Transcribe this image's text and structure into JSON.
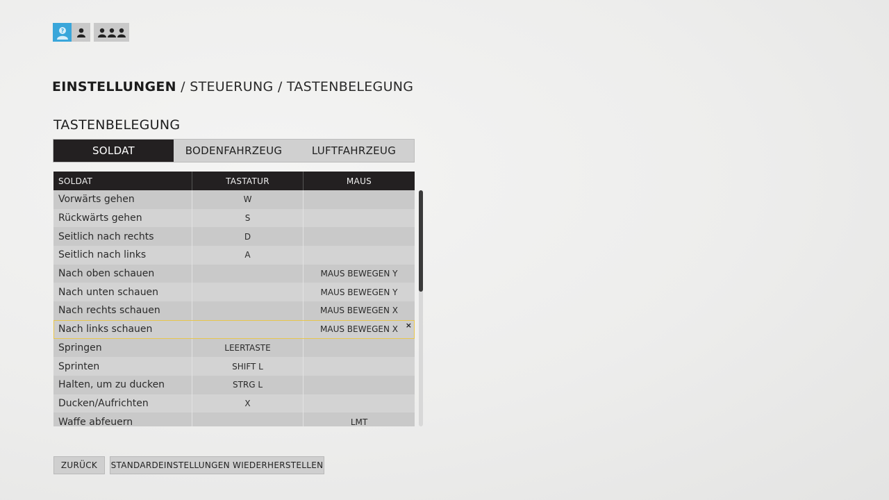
{
  "squad": {
    "icons": [
      "help-person-icon",
      "single-soldier-icon",
      "squad-icon"
    ]
  },
  "breadcrumb": {
    "current": "EINSTELLUNGEN",
    "rest": " / STEUERUNG / TASTENBELEGUNG"
  },
  "section_title": "TASTENBELEGUNG",
  "tabs": [
    {
      "label": "SOLDAT",
      "active": true
    },
    {
      "label": "BODENFAHRZEUG",
      "active": false
    },
    {
      "label": "LUFTFAHRZEUG",
      "active": false
    }
  ],
  "table": {
    "headers": [
      "SOLDAT",
      "TASTATUR",
      "MAUS"
    ],
    "rows": [
      {
        "action": "Vorwärts gehen",
        "keyboard": "W",
        "mouse": ""
      },
      {
        "action": "Rückwärts gehen",
        "keyboard": "S",
        "mouse": ""
      },
      {
        "action": "Seitlich nach rechts",
        "keyboard": "D",
        "mouse": ""
      },
      {
        "action": "Seitlich nach links",
        "keyboard": "A",
        "mouse": ""
      },
      {
        "action": "Nach oben schauen",
        "keyboard": "",
        "mouse": "MAUS BEWEGEN Y"
      },
      {
        "action": "Nach unten schauen",
        "keyboard": "",
        "mouse": "MAUS BEWEGEN Y"
      },
      {
        "action": "Nach rechts schauen",
        "keyboard": "",
        "mouse": "MAUS BEWEGEN X"
      },
      {
        "action": "Nach links schauen",
        "keyboard": "",
        "mouse": "MAUS BEWEGEN X"
      },
      {
        "action": "Springen",
        "keyboard": "LEERTASTE",
        "mouse": ""
      },
      {
        "action": "Sprinten",
        "keyboard": "SHIFT L",
        "mouse": ""
      },
      {
        "action": "Halten, um zu ducken",
        "keyboard": "STRG L",
        "mouse": ""
      },
      {
        "action": "Ducken/Aufrichten",
        "keyboard": "X",
        "mouse": ""
      },
      {
        "action": "Waffe abfeuern",
        "keyboard": "",
        "mouse": "LMT"
      }
    ],
    "selected_row": 7,
    "clear_symbol": "×"
  },
  "scroll_position": 0.0,
  "buttons": {
    "back": "ZURÜCK",
    "reset": "STANDARDEINSTELLUNGEN WIEDERHERSTELLEN"
  },
  "colors": {
    "accent_help": "#39a6da",
    "selected_outline": "#e8c64d",
    "header_dark": "#232021"
  }
}
